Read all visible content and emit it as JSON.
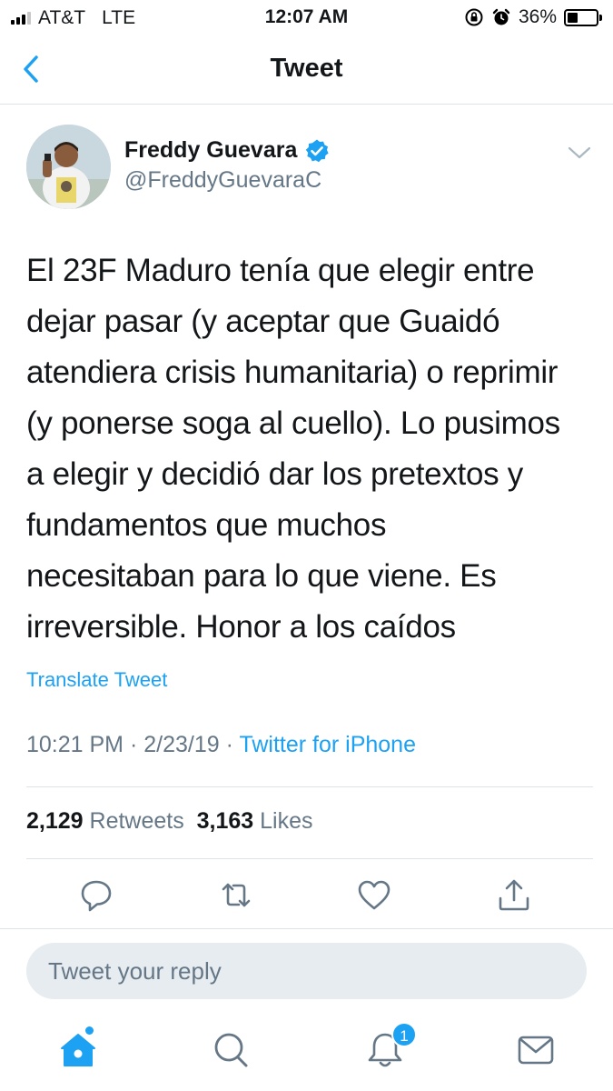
{
  "status_bar": {
    "carrier": "AT&T",
    "network": "LTE",
    "time": "12:07 AM",
    "battery_percent": "36%",
    "battery_level": 0.36,
    "signal_bars_active": 3,
    "icons": [
      "signal-icon",
      "orientation-lock-icon",
      "alarm-icon",
      "battery-icon"
    ]
  },
  "nav": {
    "title": "Tweet",
    "back_icon": "chevron-left-icon"
  },
  "author": {
    "name": "Freddy Guevara",
    "handle": "@FreddyGuevaraC",
    "verified": true,
    "avatar_icon": "avatar-photo"
  },
  "tweet": {
    "lines": [
      "El 23F Maduro tenía que elegir entre",
      "dejar pasar (y aceptar que Guaidó",
      "atendiera crisis humanitaria) o reprimir",
      "(y ponerse soga al cuello). Lo pusimos",
      "a elegir y decidió dar los pretextos y",
      "fundamentos que muchos",
      "necesitaban para lo que viene. Es",
      "irreversible. Honor a los caídos"
    ],
    "translate_label": "Translate Tweet",
    "time": "10:21 PM",
    "date": "2/23/19",
    "separator": "·",
    "source": "Twitter for iPhone"
  },
  "stats": {
    "retweets_count": "2,129",
    "retweets_label": "Retweets",
    "likes_count": "3,163",
    "likes_label": "Likes"
  },
  "actions": [
    "reply-icon",
    "retweet-icon",
    "like-icon",
    "share-icon"
  ],
  "reply": {
    "placeholder": "Tweet your reply"
  },
  "tab_bar": {
    "items": [
      "home-icon",
      "search-icon",
      "notifications-icon",
      "messages-icon"
    ],
    "notification_badge": "1"
  },
  "colors": {
    "accent": "#1da1f2",
    "secondary_text": "#657786",
    "primary_text": "#14171a",
    "divider": "#dfe3e7",
    "reply_bg": "#e6ecf0"
  }
}
